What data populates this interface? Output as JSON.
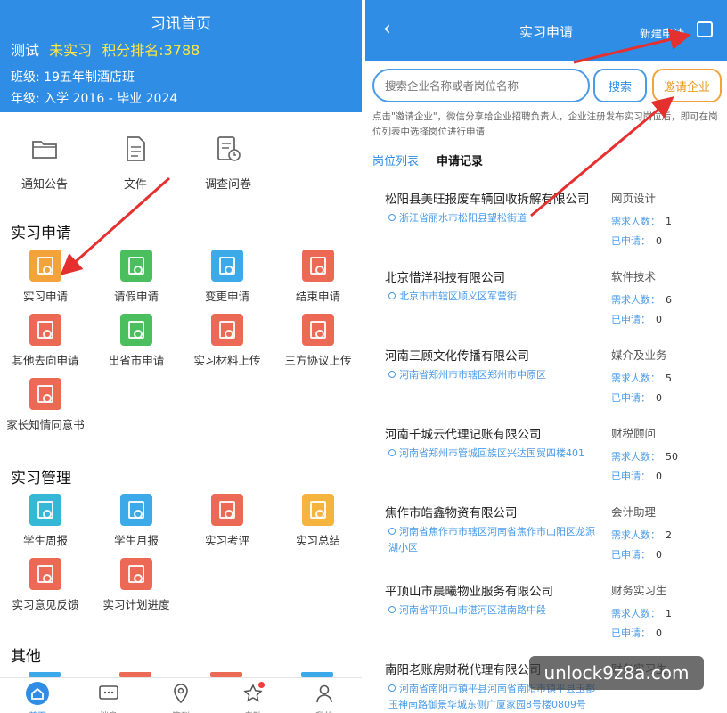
{
  "left": {
    "header": {
      "title": "习讯首页",
      "name": "测试",
      "status": "未实习",
      "rank_label": "积分排名:3788",
      "class_text": "班级: 19五年制酒店班",
      "grade_text": "年级: 入学 2016 - 毕业 2024"
    },
    "quick": [
      {
        "label": "通知公告",
        "icon": "folder-icon"
      },
      {
        "label": "文件",
        "icon": "document-icon"
      },
      {
        "label": "调查问卷",
        "icon": "survey-icon"
      }
    ],
    "section_apply": {
      "title": "实习申请",
      "items": [
        {
          "label": "实习申请",
          "color": "orange"
        },
        {
          "label": "请假申请",
          "color": "green"
        },
        {
          "label": "变更申请",
          "color": "blue"
        },
        {
          "label": "结束申请",
          "color": "red"
        },
        {
          "label": "其他去向申请",
          "color": "red"
        },
        {
          "label": "出省市申请",
          "color": "green"
        },
        {
          "label": "实习材料上传",
          "color": "red"
        },
        {
          "label": "三方协议上传",
          "color": "red"
        },
        {
          "label": "家长知情同意书",
          "color": "red"
        }
      ]
    },
    "section_manage": {
      "title": "实习管理",
      "items": [
        {
          "label": "学生周报",
          "color": "cyan"
        },
        {
          "label": "学生月报",
          "color": "blue"
        },
        {
          "label": "实习考评",
          "color": "red"
        },
        {
          "label": "实习总结",
          "color": "amber"
        },
        {
          "label": "实习意见反馈",
          "color": "red"
        },
        {
          "label": "实习计划进度",
          "color": "red"
        }
      ]
    },
    "section_other": {
      "title": "其他"
    },
    "tabbar": [
      {
        "label": "首页",
        "icon": "home-icon"
      },
      {
        "label": "消息",
        "icon": "message-icon"
      },
      {
        "label": "签到",
        "icon": "location-pin-icon"
      },
      {
        "label": "考勤",
        "icon": "star-icon"
      },
      {
        "label": "我的",
        "icon": "user-icon"
      }
    ]
  },
  "right": {
    "header": {
      "back_icon": "back-arrow-icon",
      "title": "实习申请",
      "new_apply": "新建申请"
    },
    "search": {
      "placeholder": "搜索企业名称或者岗位名称",
      "search_label": "搜索",
      "invite_label": "邀请企业"
    },
    "hint": "点击\"邀请企业\"，微信分享给企业招聘负责人，企业注册发布实习岗位后，即可在岗位列表中选择岗位进行申请",
    "tabs": [
      {
        "label": "岗位列表"
      },
      {
        "label": "申请记录"
      }
    ],
    "need_label": "需求人数：",
    "applied_label": "已申请：",
    "companies": [
      {
        "name": "松阳县美旺报废车辆回收拆解有限公司",
        "job": "网页设计",
        "address": "浙江省丽水市松阳县望松街道",
        "need": "1",
        "applied": "0"
      },
      {
        "name": "北京惜洋科技有限公司",
        "job": "软件技术",
        "address": "北京市市辖区顺义区军营街",
        "need": "6",
        "applied": "0"
      },
      {
        "name": "河南三顾文化传播有限公司",
        "job": "媒介及业务",
        "address": "河南省郑州市市辖区郑州市中原区",
        "need": "5",
        "applied": "0"
      },
      {
        "name": "河南千城云代理记账有限公司",
        "job": "财税顾问",
        "address": "河南省郑州市管城回族区兴达国贸四楼401",
        "need": "50",
        "applied": "0"
      },
      {
        "name": "焦作市皓鑫物资有限公司",
        "job": "会计助理",
        "address": "河南省焦作市市辖区河南省焦作市山阳区龙源湖小区",
        "need": "2",
        "applied": "0"
      },
      {
        "name": "平顶山市晨曦物业服务有限公司",
        "job": "财务实习生",
        "address": "河南省平顶山市湛河区湛南路中段",
        "need": "1",
        "applied": "0"
      },
      {
        "name": "南阳老账房财税代理有限公司",
        "job": "财务实习生",
        "address": "河南省南阳市镇平县河南省南阳市镇平县玉都玉神南路御景华城东侧广厦家园8号楼0809号",
        "need": "",
        "applied": ""
      }
    ]
  },
  "watermark": "unlock9z8a.com"
}
